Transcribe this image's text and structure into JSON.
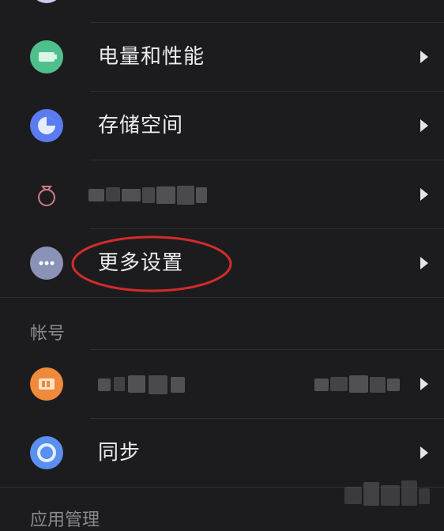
{
  "items": {
    "battery": {
      "label": "电量和性能",
      "icon": "battery-icon",
      "color": "#4fc08d"
    },
    "storage": {
      "label": "存储空间",
      "icon": "storage-pie-icon",
      "color": "#5b7cf0"
    },
    "redacted": {
      "icon": "ring-icon",
      "color": "#d27a8a"
    },
    "more": {
      "label": "更多设置",
      "icon": "more-dots-icon",
      "color": "#8a92b8"
    }
  },
  "section_account": {
    "label": "帐号"
  },
  "account_items": {
    "account": {
      "icon": "account-card-icon",
      "color": "#f08a3a"
    },
    "sync": {
      "label": "同步",
      "icon": "sync-icon",
      "color": "#5b8ff0"
    }
  },
  "section_app": {
    "label": "应用管理"
  },
  "highlight": {
    "color": "#d42a2a"
  }
}
